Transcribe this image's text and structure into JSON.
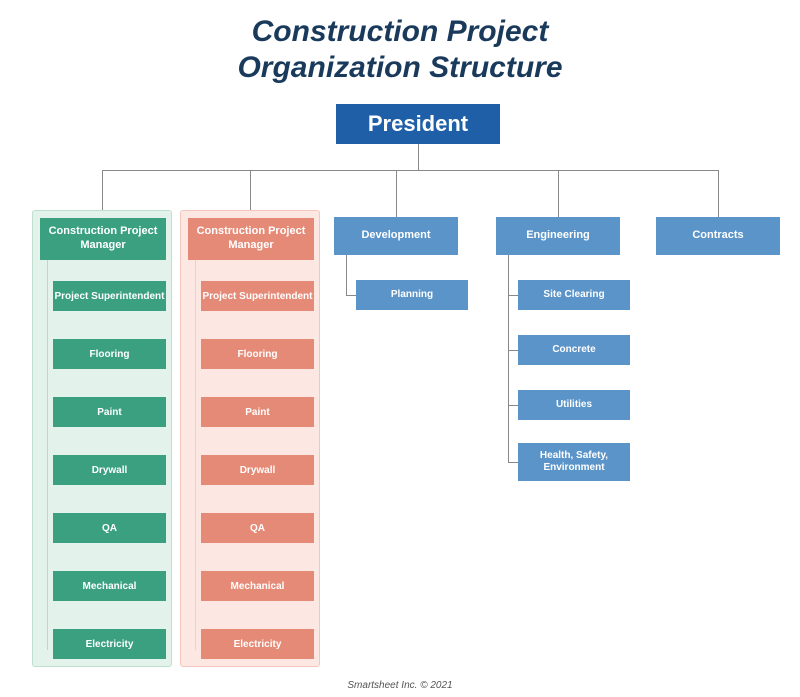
{
  "title_line1": "Construction Project",
  "title_line2": "Organization Structure",
  "president": "President",
  "col_green": {
    "head": "Construction Project Manager",
    "items": [
      "Project Superintendent",
      "Flooring",
      "Paint",
      "Drywall",
      "QA",
      "Mechanical",
      "Electricity"
    ]
  },
  "col_salmon": {
    "head": "Construction Project Manager",
    "items": [
      "Project Superintendent",
      "Flooring",
      "Paint",
      "Drywall",
      "QA",
      "Mechanical",
      "Electricity"
    ]
  },
  "development": {
    "head": "Development",
    "items": [
      "Planning"
    ]
  },
  "engineering": {
    "head": "Engineering",
    "items": [
      "Site Clearing",
      "Concrete",
      "Utilities",
      "Health, Safety, Environment"
    ]
  },
  "contracts": {
    "head": "Contracts"
  },
  "footer": "Smartsheet Inc. © 2021"
}
